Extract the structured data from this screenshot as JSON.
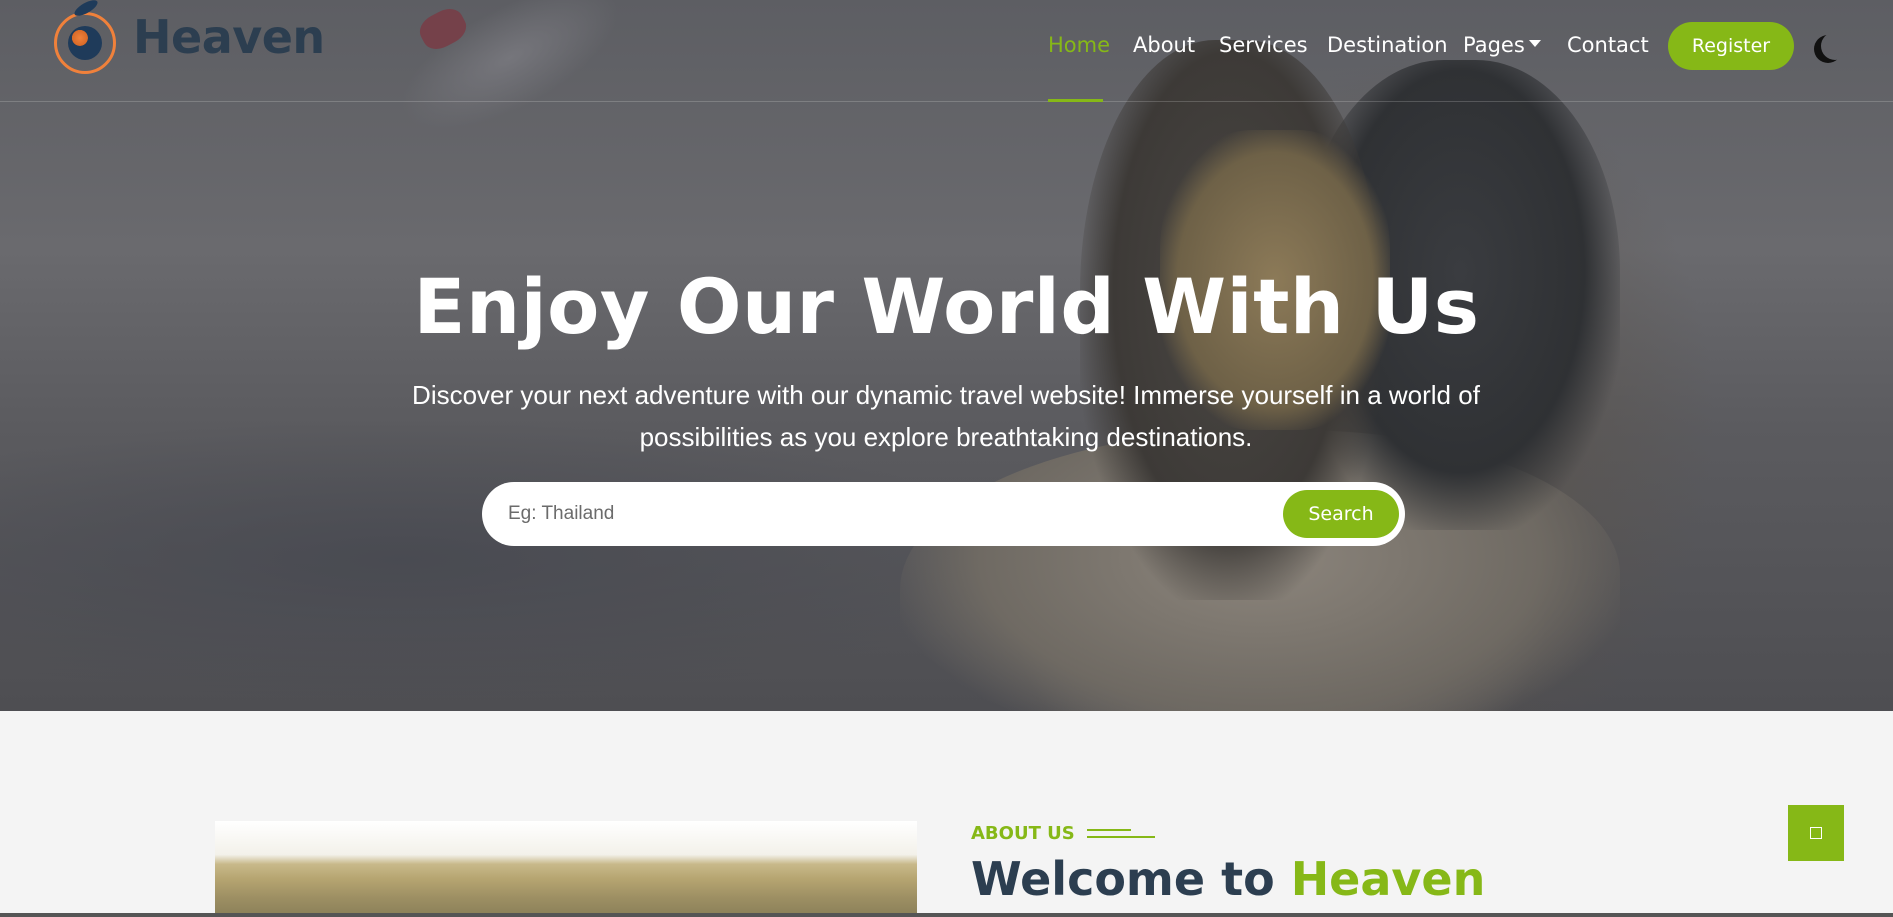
{
  "brand": {
    "name": "Heaven",
    "accent_color": "#86b817",
    "dark_color": "#2c3e50",
    "logo_icon": "globe-plane-logo"
  },
  "nav": {
    "items": [
      {
        "label": "Home",
        "active": true
      },
      {
        "label": "About"
      },
      {
        "label": "Services"
      },
      {
        "label": "Destination"
      },
      {
        "label": "Pages",
        "dropdown": true
      },
      {
        "label": "Contact"
      }
    ],
    "register_label": "Register",
    "theme_toggle_icon": "moon-icon"
  },
  "hero": {
    "title": "Enjoy Our World With Us",
    "subtitle": "Discover your next adventure with our dynamic travel website! Immerse yourself in a world of possibilities as you explore breathtaking destinations.",
    "search": {
      "placeholder": "Eg: Thailand",
      "value": "",
      "button_label": "Search"
    }
  },
  "about": {
    "label": "ABOUT US",
    "title_prefix": "Welcome to ",
    "title_brand": "Heaven"
  },
  "back_to_top": {
    "icon": "arrow-up-icon",
    "glyph": "□"
  }
}
